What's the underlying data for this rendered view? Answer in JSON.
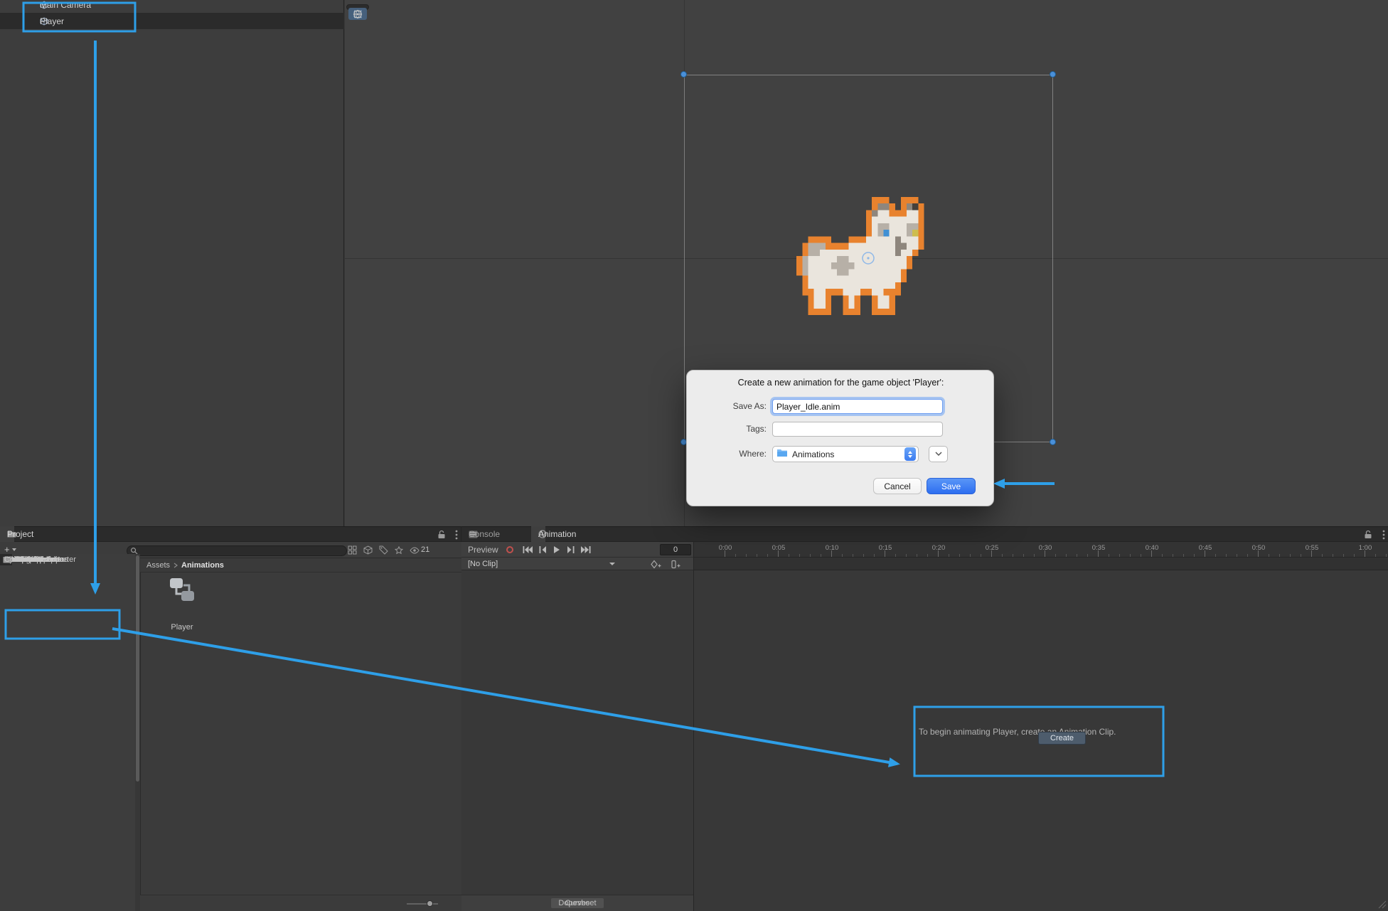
{
  "colors": {
    "annotation_blue": "#2E9FE8",
    "handle_blue": "#4A90D9",
    "macos_blue": "#3B7BF2"
  },
  "hierarchy": {
    "items": [
      {
        "label": "Main Camera",
        "selected": false
      },
      {
        "label": "Player",
        "selected": true
      }
    ]
  },
  "scene_toolbar": {
    "tools": [
      {
        "name": "hand-tool",
        "selected": false
      },
      {
        "name": "move-tool",
        "selected": false
      },
      {
        "name": "rotate-tool",
        "selected": false
      },
      {
        "name": "scale-tool",
        "selected": false
      },
      {
        "name": "rect-tool",
        "selected": true
      },
      {
        "name": "transform-tool",
        "selected": false
      },
      {
        "name": "editor-tool",
        "selected": false
      }
    ]
  },
  "dialog": {
    "title": "Create a new animation for the game object 'Player':",
    "fields": {
      "save_as": {
        "label": "Save As:",
        "value": "Player_Idle.anim"
      },
      "tags": {
        "label": "Tags:",
        "value": ""
      },
      "where": {
        "label": "Where:",
        "value": "Animations"
      }
    },
    "buttons": {
      "cancel": "Cancel",
      "save": "Save"
    }
  },
  "project": {
    "tab_label": "Project",
    "create_button": "+",
    "search_placeholder": "",
    "visible_count": "21",
    "breadcrumb": {
      "root": "Assets",
      "current": "Animations"
    },
    "assets": [
      {
        "label": "Player",
        "type": "animator-controller"
      }
    ],
    "tree": [
      {
        "label": "Favorites",
        "depth": 0,
        "icon": "star",
        "arrow": "down"
      },
      {
        "label": "All Materials",
        "depth": 1,
        "icon": "search"
      },
      {
        "label": "All Models",
        "depth": 1,
        "icon": "search"
      },
      {
        "label": "All Prefabs",
        "depth": 1,
        "icon": "search"
      },
      {
        "spacer": true
      },
      {
        "label": "Assets",
        "depth": 0,
        "icon": "none",
        "arrow": "down"
      },
      {
        "label": "Animations",
        "depth": 1,
        "icon": "folder",
        "selected": true
      },
      {
        "label": "Pet Cats pack",
        "depth": 1,
        "icon": "folder",
        "arrow": "down"
      },
      {
        "label": "Demo",
        "depth": 2,
        "icon": "folder",
        "arrow": "down"
      },
      {
        "label": "Animations",
        "depth": 3,
        "icon": "folder"
      },
      {
        "label": "Scene",
        "depth": 3,
        "icon": "folder"
      },
      {
        "label": "Sprites",
        "depth": 2,
        "icon": "folder",
        "arrow": "down"
      },
      {
        "label": "Cat-1",
        "depth": 3,
        "icon": "folder"
      },
      {
        "label": "Cat-2",
        "depth": 3,
        "icon": "folder"
      },
      {
        "label": "Cat-3",
        "depth": 3,
        "icon": "folder"
      },
      {
        "label": "Cat-4",
        "depth": 3,
        "icon": "folder"
      },
      {
        "label": "Cat-5",
        "depth": 3,
        "icon": "folder"
      },
      {
        "label": "Cat-6",
        "depth": 3,
        "icon": "folder"
      },
      {
        "label": "Meow-VFX",
        "depth": 3,
        "icon": "folder"
      },
      {
        "label": "Scenes",
        "depth": 1,
        "icon": "folder"
      },
      {
        "label": "Packages",
        "depth": 0,
        "icon": "folder",
        "arrow": "down"
      },
      {
        "label": "2D Animation",
        "depth": 1,
        "icon": "folder",
        "arrow": "right"
      },
      {
        "label": "2D Aseprite Importer",
        "depth": 1,
        "icon": "folder",
        "arrow": "right"
      },
      {
        "label": "2D Common",
        "depth": 1,
        "icon": "folder",
        "arrow": "right"
      },
      {
        "label": "2D Pixel Perfect",
        "depth": 1,
        "icon": "folder",
        "arrow": "right"
      },
      {
        "label": "2D PSD Importer",
        "depth": 1,
        "icon": "folder",
        "arrow": "right"
      },
      {
        "label": "2D Sprite",
        "depth": 1,
        "icon": "folder",
        "arrow": "right"
      },
      {
        "label": "2D SpriteShape",
        "depth": 1,
        "icon": "folder",
        "arrow": "right"
      },
      {
        "label": "2D Tilemap Editor",
        "depth": 1,
        "icon": "folder",
        "arrow": "right"
      },
      {
        "label": "2D Tilemap Extras",
        "depth": 1,
        "icon": "folder",
        "arrow": "right"
      },
      {
        "label": "Burst",
        "depth": 1,
        "icon": "folder",
        "arrow": "right"
      },
      {
        "label": "Collections",
        "depth": 1,
        "icon": "folder",
        "arrow": "right"
      }
    ]
  },
  "console": {
    "tab_label": "Console"
  },
  "animation": {
    "tab_label": "Animation",
    "preview_label": "Preview",
    "frame_field": "0",
    "clip_dropdown": "[No Clip]",
    "ruler": [
      "0:00",
      "0:05",
      "0:10",
      "0:15",
      "0:20",
      "0:25",
      "0:30",
      "0:35",
      "0:40",
      "0:45",
      "0:50",
      "0:55",
      "1:00"
    ],
    "empty_state": {
      "message": "To begin animating Player, create an Animation Clip.",
      "button": "Create"
    },
    "mode_buttons": {
      "dopesheet": "Dopesheet",
      "curves": "Curves"
    }
  }
}
